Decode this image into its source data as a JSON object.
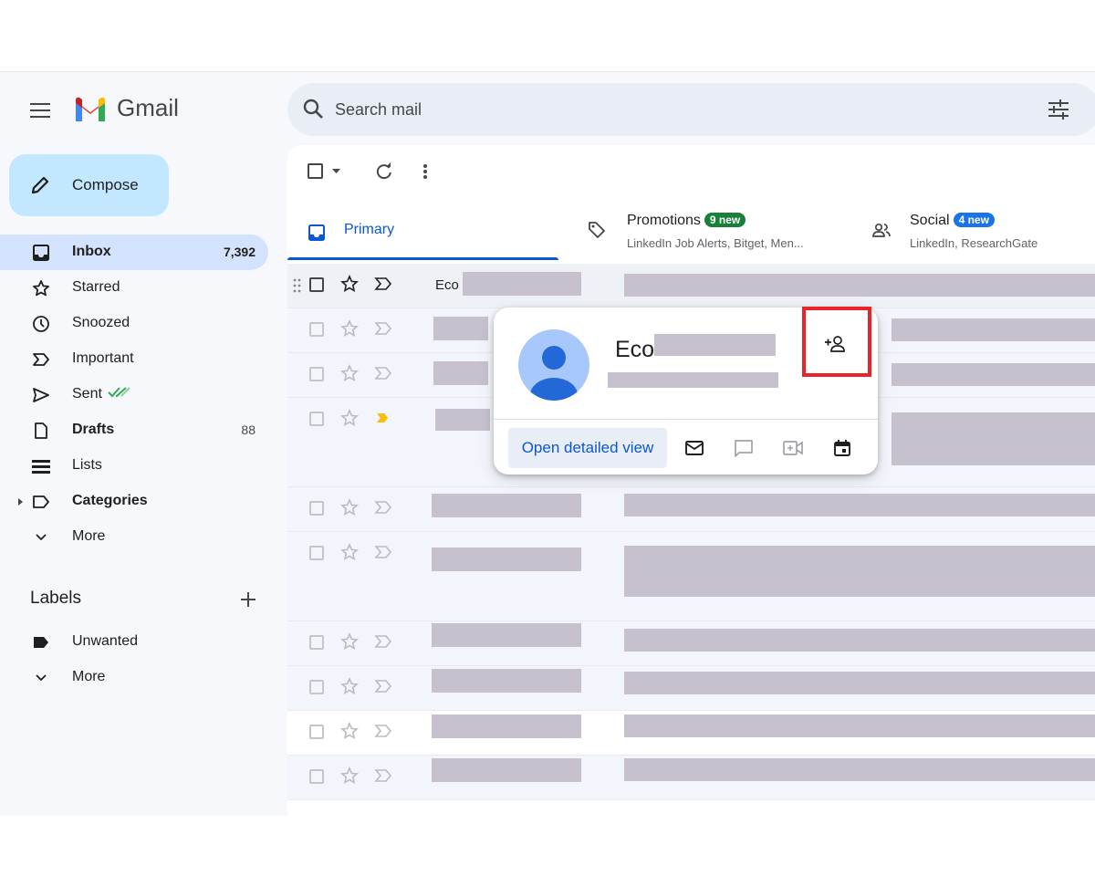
{
  "header": {
    "app_name": "Gmail",
    "search_placeholder": "Search mail"
  },
  "sidebar": {
    "compose_label": "Compose",
    "items": [
      {
        "label": "Inbox",
        "count": "7,392",
        "icon": "inbox-icon",
        "active": true
      },
      {
        "label": "Starred",
        "count": "",
        "icon": "star-icon"
      },
      {
        "label": "Snoozed",
        "count": "",
        "icon": "clock-icon"
      },
      {
        "label": "Important",
        "count": "",
        "icon": "important-icon"
      },
      {
        "label": "Sent",
        "count": "",
        "icon": "send-icon"
      },
      {
        "label": "Drafts",
        "count": "88",
        "icon": "draft-icon"
      },
      {
        "label": "Lists",
        "count": "",
        "icon": "list-icon"
      },
      {
        "label": "Categories",
        "count": "",
        "icon": "label-outline-icon"
      },
      {
        "label": "More",
        "count": "",
        "icon": "chevron-down-icon"
      }
    ],
    "labels_heading": "Labels",
    "labels": [
      {
        "label": "Unwanted",
        "icon": "label-icon"
      },
      {
        "label": "More",
        "icon": "chevron-down-icon"
      }
    ]
  },
  "tabs": [
    {
      "label": "Primary",
      "badge": "",
      "sub": ""
    },
    {
      "label": "Promotions",
      "badge": "9 new",
      "badge_color": "#188038",
      "sub": "LinkedIn Job Alerts, Bitget, Men..."
    },
    {
      "label": "Social",
      "badge": "4 new",
      "badge_color": "#1a73e8",
      "sub": "LinkedIn, ResearchGate"
    }
  ],
  "rows": {
    "first_sender": "Eco"
  },
  "popup": {
    "name": "Eco",
    "open_detailed_view": "Open detailed view"
  },
  "colors": {
    "accent": "#0b57d0",
    "compose_bg": "#c2e7ff",
    "active_nav_bg": "#d3e3fd",
    "redaction": "#c7c1cd",
    "highlight": "#e8252a",
    "important_marker": "#fbbc04"
  }
}
